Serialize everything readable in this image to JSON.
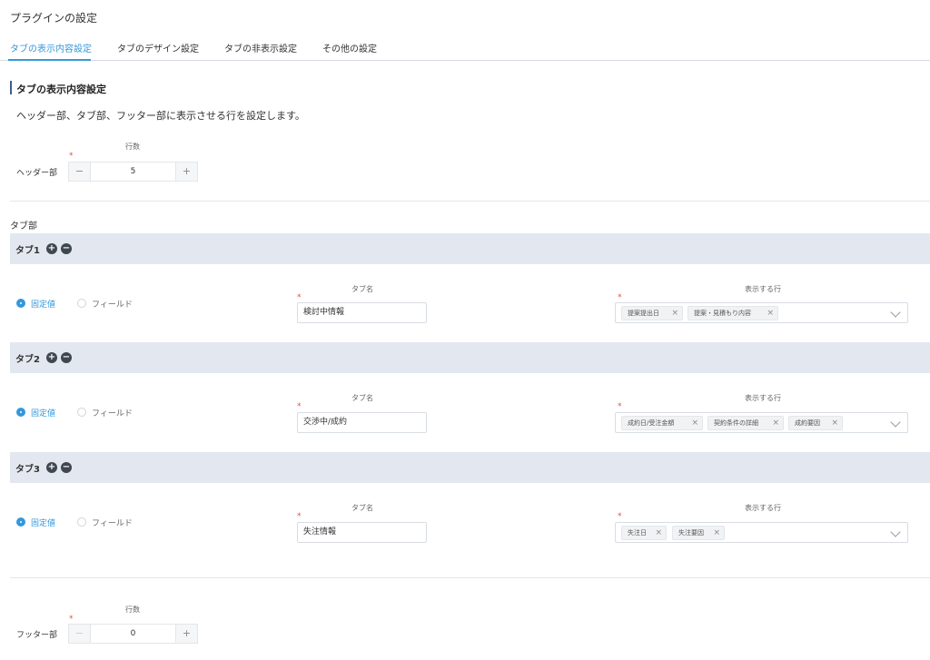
{
  "page": {
    "title": "プラグインの設定"
  },
  "nav": {
    "tabs": [
      "タブの表示内容設定",
      "タブのデザイン設定",
      "タブの非表示設定",
      "その他の設定"
    ]
  },
  "section": {
    "title": "タブの表示内容設定",
    "description": "ヘッダー部、タブ部、フッター部に表示させる行を設定します。"
  },
  "header_part": {
    "label": "ヘッダー部",
    "count_label": "行数",
    "value": "5"
  },
  "tab_part_label": "タブ部",
  "tabs_config": [
    {
      "label": "タブ1",
      "radio_fixed": "固定値",
      "radio_field": "フィールド",
      "name_label": "タブ名",
      "name_value": "検討中情報",
      "rows_label": "表示する行",
      "rows": [
        "提案提出日",
        "提案・見積もり内容"
      ]
    },
    {
      "label": "タブ2",
      "radio_fixed": "固定値",
      "radio_field": "フィールド",
      "name_label": "タブ名",
      "name_value": "交渉中/成約",
      "rows_label": "表示する行",
      "rows": [
        "成約日/受注金額",
        "契約条件の詳細",
        "成約要因"
      ]
    },
    {
      "label": "タブ3",
      "radio_fixed": "固定値",
      "radio_field": "フィールド",
      "name_label": "タブ名",
      "name_value": "失注情報",
      "rows_label": "表示する行",
      "rows": [
        "失注日",
        "失注要因"
      ]
    }
  ],
  "footer_part": {
    "label": "フッター部",
    "count_label": "行数",
    "value": "0"
  },
  "icons": {
    "add": "+",
    "remove": "−",
    "minus": "−",
    "plus": "+",
    "chip_remove": "×"
  },
  "colors": {
    "accent": "#3498db",
    "required": "#e74c3c",
    "tab_header_bg": "#e3e8f0"
  }
}
